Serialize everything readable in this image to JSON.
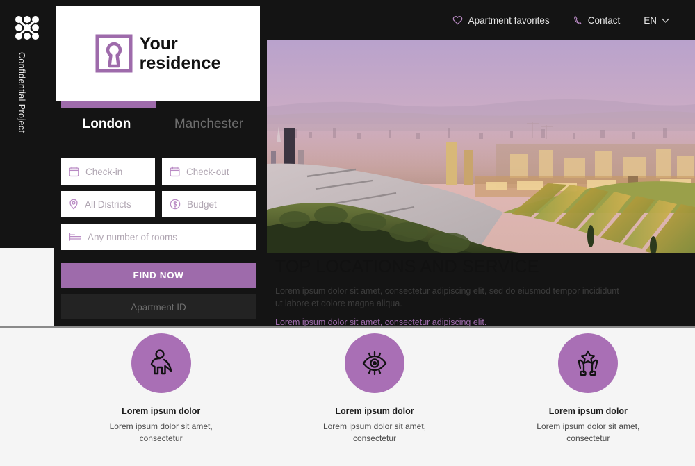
{
  "rail": {
    "logo_icon": "dot-grid-logo",
    "label": "Confidential Project"
  },
  "topnav": {
    "favorites": {
      "label": "Apartment favorites",
      "icon": "heart-icon"
    },
    "contact": {
      "label": "Contact",
      "icon": "phone-icon"
    },
    "language": {
      "label": "EN",
      "icon": "chevron-down-icon"
    }
  },
  "brand": {
    "logo_icon": "keyhole-logo",
    "line1": "Your",
    "line2": "residence",
    "accent_color": "#9e6bab"
  },
  "tabs": [
    {
      "label": "London",
      "active": true
    },
    {
      "label": "Manchester",
      "active": false
    }
  ],
  "search": {
    "checkin": {
      "label": "Check-in",
      "icon": "calendar-icon"
    },
    "checkout": {
      "label": "Check-out",
      "icon": "calendar-icon"
    },
    "districts": {
      "label": "All Districts",
      "icon": "map-pin-icon"
    },
    "budget": {
      "label": "Budget",
      "icon": "dollar-circle-icon"
    },
    "rooms": {
      "label": "Any number of rooms",
      "icon": "bed-icon"
    },
    "find_label": "FIND NOW",
    "apartment_id": "Apartment ID"
  },
  "hero": {
    "title": "TOP LOCATIONS AND SERVICE",
    "body": "Lorem ipsum dolor sit amet, consectetur adipiscing elit, sed do eiusmod tempor incididunt ut labore et dolore magna aliqua.",
    "link": "Lorem ipsum dolor sit amet, consectetur adipiscing elit."
  },
  "features": [
    {
      "icon": "superhero-icon",
      "title": "Lorem ipsum dolor",
      "desc": "Lorem ipsum dolor sit amet, consectetur"
    },
    {
      "icon": "eye-icon",
      "title": "Lorem ipsum dolor",
      "desc": "Lorem ipsum dolor sit amet, consectetur"
    },
    {
      "icon": "hands-star-icon",
      "title": "Lorem ipsum dolor",
      "desc": "Lorem ipsum dolor sit amet, consectetur"
    }
  ]
}
